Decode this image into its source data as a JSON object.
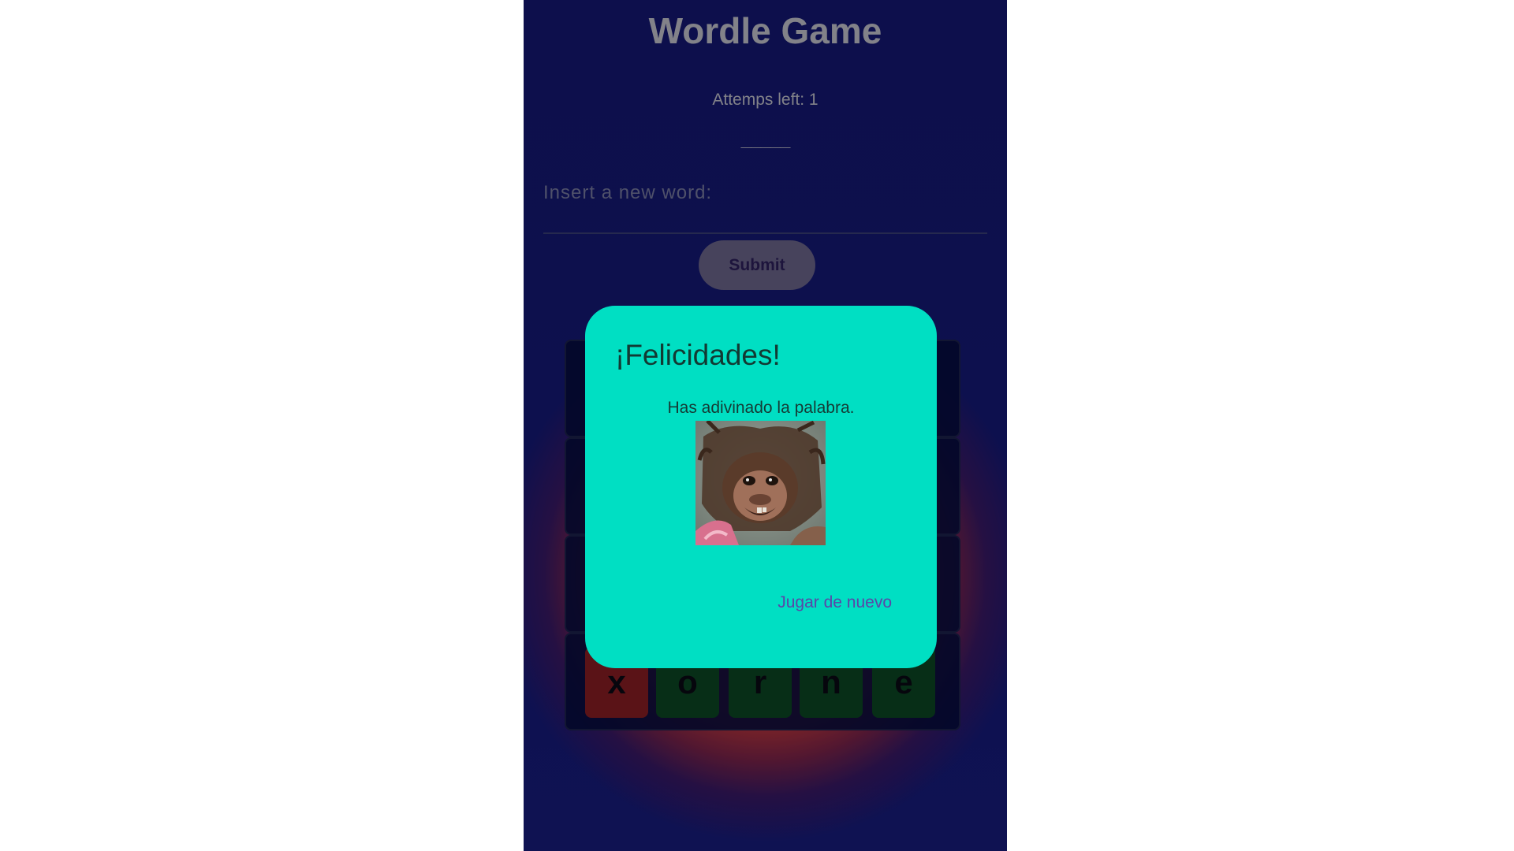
{
  "app": {
    "title": "Wordle Game",
    "attempts_text": "Attemps left: 1",
    "hidden_word": "_____"
  },
  "input": {
    "placeholder": "Insert a new word:",
    "value": ""
  },
  "submit_label": "Submit",
  "board": {
    "rows": [
      {
        "letters": [
          "",
          "",
          "",
          "",
          ""
        ]
      },
      {
        "letters": [
          "",
          "",
          "",
          "",
          ""
        ]
      },
      {
        "letters": [
          "",
          "",
          "",
          "",
          ""
        ]
      },
      {
        "letters": [
          "x",
          "o",
          "r",
          "n",
          "e"
        ],
        "states": [
          "wrong",
          "correct",
          "correct",
          "correct",
          "correct"
        ]
      }
    ]
  },
  "dialog": {
    "title": "¡Felicidades!",
    "message": "Has adivinado la palabra.",
    "image_icon": "monkey-photo",
    "action_label": "Jugar de nuevo"
  },
  "colors": {
    "background": "#15196d",
    "dialog": "#00dfc3",
    "tile_correct": "#0c4819",
    "tile_wrong": "#8b1e1a",
    "action_text": "#5a46a8"
  }
}
